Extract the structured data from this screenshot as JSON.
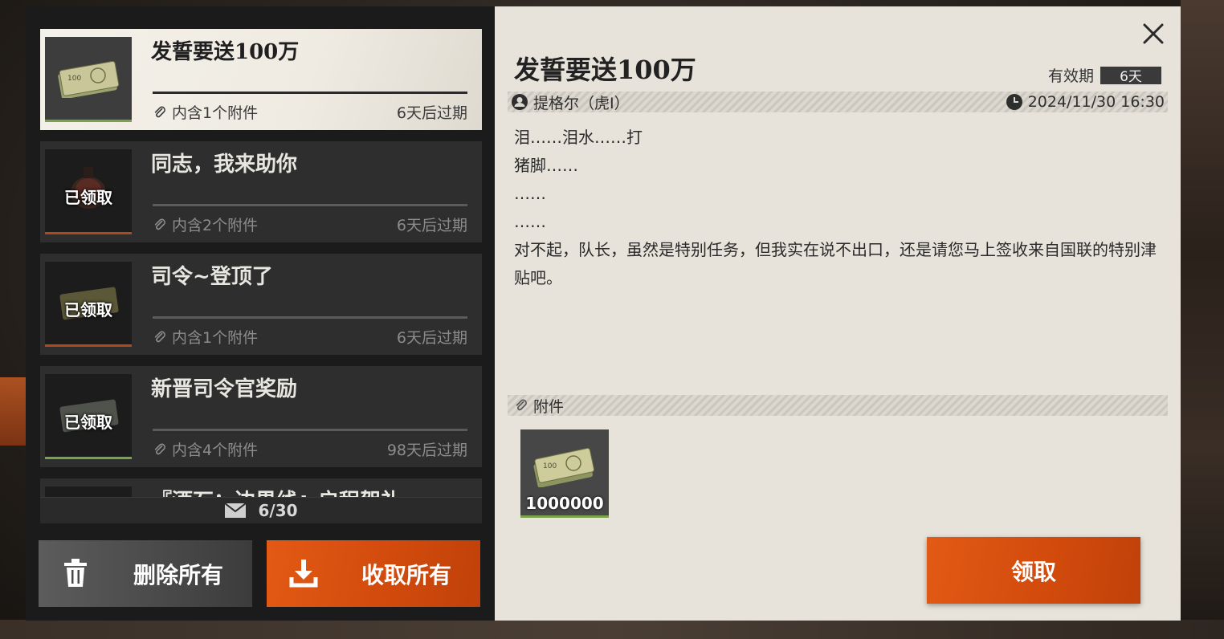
{
  "mail_list": [
    {
      "title": "发誓要送100万",
      "attachments": "内含1个附件",
      "expire": "6天后过期",
      "claimed": false,
      "thumb": "banknote-icon"
    },
    {
      "title": "同志，我来助你",
      "attachments": "内含2个附件",
      "expire": "6天后过期",
      "claimed": true,
      "claimed_label": "已领取",
      "thumb": "armor-icon"
    },
    {
      "title": "司令~登顶了",
      "attachments": "内含1个附件",
      "expire": "6天后过期",
      "claimed": true,
      "claimed_label": "已领取",
      "thumb": "banknote-icon"
    },
    {
      "title": "新晋司令官奖励",
      "attachments": "内含4个附件",
      "expire": "98天后过期",
      "claimed": true,
      "claimed_label": "已领取",
      "thumb": "banknote-icon"
    },
    {
      "title": "『酒石：边界线』启程贺礼",
      "attachments": "",
      "expire": ""
    }
  ],
  "counter": "6/30",
  "buttons": {
    "delete_all": "删除所有",
    "collect_all": "收取所有",
    "claim": "领取"
  },
  "detail": {
    "title": "发誓要送100万",
    "validity_label": "有效期",
    "validity_value": "6天",
    "sender": "提格尔（虎I）",
    "datetime": "2024/11/30 16:30",
    "body_lines": [
      "泪……泪水……打",
      "猪脚……",
      "……",
      "……",
      "对不起，队长，虽然是特别任务，但我实在说不出口，还是请您马上签收来自国联的特别津贴吧。"
    ],
    "attachments_label": "附件",
    "reward_quantity": "1000000"
  },
  "colors": {
    "accent": "#d14a0c",
    "active_bar": "#79a34a",
    "panel_light": "#e7e3da",
    "panel_dark": "#1b1b1b"
  }
}
